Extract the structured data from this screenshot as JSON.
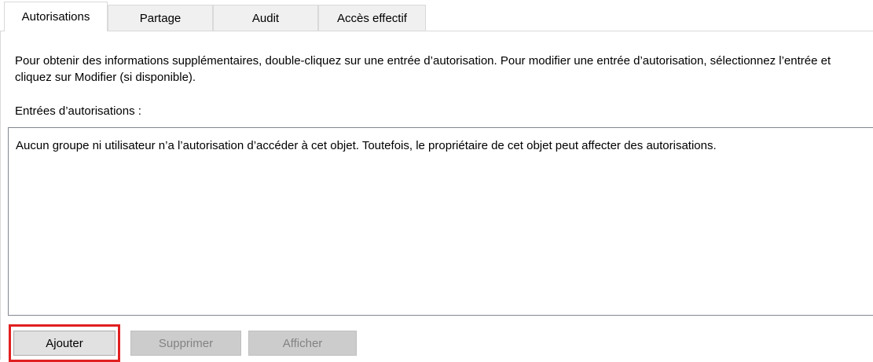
{
  "tabs": [
    {
      "label": "Autorisations",
      "active": true
    },
    {
      "label": "Partage",
      "active": false
    },
    {
      "label": "Audit",
      "active": false
    },
    {
      "label": "Accès effectif",
      "active": false
    }
  ],
  "help_text": "Pour obtenir des informations supplémentaires, double-cliquez sur une entrée d’autorisation. Pour modifier une entrée d’autorisation, sélectionnez l’entrée et cliquez sur Modifier (si disponible).",
  "entries": {
    "label": "Entrées d’autorisations :",
    "empty_message": "Aucun groupe ni utilisateur n’a l’autorisation d’accéder à cet objet. Toutefois, le propriétaire de cet objet peut affecter des autorisations."
  },
  "buttons": {
    "add": "Ajouter",
    "remove": "Supprimer",
    "view": "Afficher"
  },
  "colors": {
    "highlight": "#e02020",
    "disabled_button_bg": "#cccccc",
    "disabled_button_text": "#838383"
  }
}
